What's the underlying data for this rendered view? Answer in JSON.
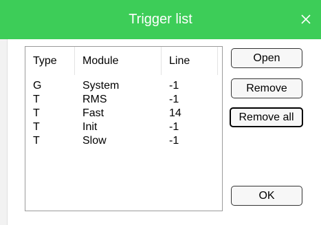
{
  "dialog": {
    "title": "Trigger list",
    "title_bar_color": "#3dcd58",
    "close_icon": "close-icon"
  },
  "list": {
    "columns": [
      "Type",
      "Module",
      "Line"
    ],
    "rows": [
      {
        "type": "G",
        "module": "System",
        "line": "-1"
      },
      {
        "type": "T",
        "module": "RMS",
        "line": "-1"
      },
      {
        "type": "T",
        "module": "Fast",
        "line": "14"
      },
      {
        "type": "T",
        "module": "Init",
        "line": "-1"
      },
      {
        "type": "T",
        "module": "Slow",
        "line": "-1"
      }
    ]
  },
  "buttons": {
    "open": "Open",
    "remove": "Remove",
    "remove_all": "Remove all",
    "ok": "OK"
  }
}
